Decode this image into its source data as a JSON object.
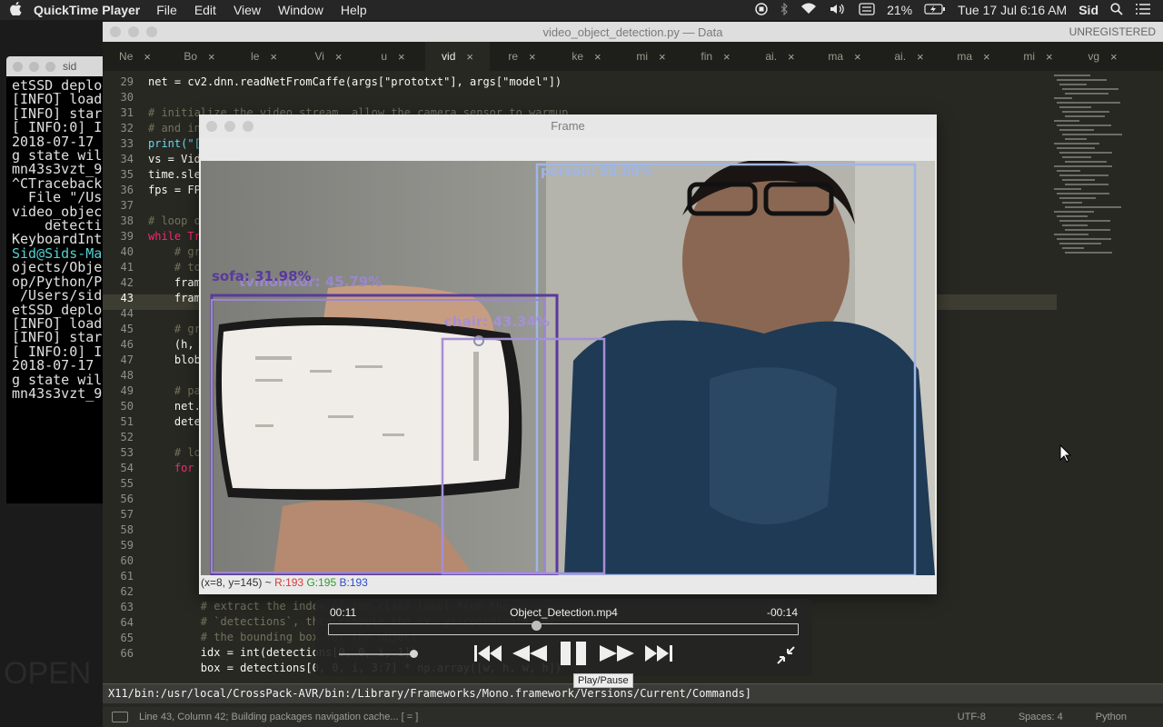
{
  "menubar": {
    "app_name": "QuickTime Player",
    "menus": [
      "File",
      "Edit",
      "View",
      "Window",
      "Help"
    ],
    "battery": "21%",
    "datetime": "Tue 17 Jul  6:16 AM",
    "user": "Sid"
  },
  "desktop": {
    "text": "OPEN"
  },
  "terminal": {
    "title": "sid",
    "lines": [
      "etSSD_deplo",
      "[INFO] load",
      "[INFO] star",
      "[ INFO:0] I",
      "2018-07-17 ",
      "g state wil",
      "mn43s3vzt_9",
      "^CTraceback",
      "  File \"/Us",
      "video_objec",
      "    detecti",
      "KeyboardInt",
      "Sid@Sids-Ma",
      "ojects/Obje",
      "op/Python/P",
      " /Users/sid",
      "etSSD_deplo",
      "[INFO] load",
      "[INFO] star",
      "[ INFO:0] I",
      "2018-07-17 ",
      "g state wil",
      "mn43s3vzt_9"
    ]
  },
  "sublime": {
    "title": "video_object_detection.py — Data",
    "registration": "UNREGISTERED",
    "tabs": [
      "Ne",
      "Bo",
      "le",
      "Vi",
      "u",
      "vid",
      "re",
      "ke",
      "mi",
      "fin",
      "ai.",
      "ma",
      "ai.",
      "ma",
      "mi",
      "vg"
    ],
    "active_tab": 5,
    "line_numbers": [
      "29",
      "30",
      "31",
      "32",
      "33",
      "34",
      "35",
      "36",
      "37",
      "38",
      "39",
      "40",
      "41",
      "42",
      "43",
      "44",
      "45",
      "46",
      "47",
      "48",
      "49",
      "50",
      "51",
      "52",
      "53",
      "54",
      "55",
      "56",
      "57",
      "58",
      "59",
      "60",
      "61",
      "62",
      "63",
      "64",
      "65",
      "66"
    ],
    "code_lines": {
      "l29": "net = cv2.dnn.readNetFromCaffe(args[\"prototxt\"], args[\"model\"])",
      "l31": "# initialize the video stream, allow the camera sensor to warmup,",
      "l32": "# and in",
      "l33": "print(\"[",
      "l34": "vs = Vid",
      "l35": "time.sle",
      "l36": "fps = FP",
      "l38": "# loop o",
      "l39": "while Tr",
      "l40": "    # gr",
      "l41": "    # to",
      "l42": "    fram",
      "l43": "    fram",
      "l45": "    # gr",
      "l46": "    (h, ",
      "l47": "    blob",
      "l49": "    # pa",
      "l50": "    net.",
      "l51": "    dete",
      "l53": "    # lo",
      "l54": "    for ",
      "l62": "        # extract the index of the class label from the",
      "l63": "        # `detections`, then compute the (x, y)-coordinates of",
      "l64": "        # the bounding box for the object",
      "l65": "        idx = int(detections[0, 0, i, 1])",
      "l66": "        box = detections[0, 0, i, 3:7] * np.array([w, h, w, h])"
    },
    "command_bar": "X11/bin:/usr/local/CrossPack-AVR/bin:/Library/Frameworks/Mono.framework/Versions/Current/Commands]",
    "status_left": "Line 43, Column 42; Building packages navigation cache... [   =   ]",
    "encoding": "UTF-8",
    "indent": "Spaces: 4",
    "syntax": "Python"
  },
  "frame_window": {
    "title": "Frame",
    "detections": [
      {
        "label": "person: 98.09%"
      },
      {
        "label": "sofa: 31.98%"
      },
      {
        "label": "tvmonitor: 45.79%"
      },
      {
        "label": "chair: 43.34%"
      }
    ],
    "pixel_info": {
      "coords": "(x=8, y=145) ~",
      "r": "R:193",
      "g": "G:195",
      "b": "B:193"
    }
  },
  "quicktime": {
    "elapsed": "00:11",
    "filename": "Object_Detection.mp4",
    "remaining": "-00:14",
    "playback_progress": 0.44,
    "volume_level": 0.95,
    "tooltip": "Play/Pause"
  },
  "colors": {
    "editor_bg": "#272822",
    "keyword": "#f92672",
    "function": "#66d9ef",
    "string": "#e6db74",
    "comment": "#75715e",
    "box_person": "#9fb6e6",
    "box_sofa": "#5a3a9c",
    "box_chair": "#a58fd8"
  }
}
